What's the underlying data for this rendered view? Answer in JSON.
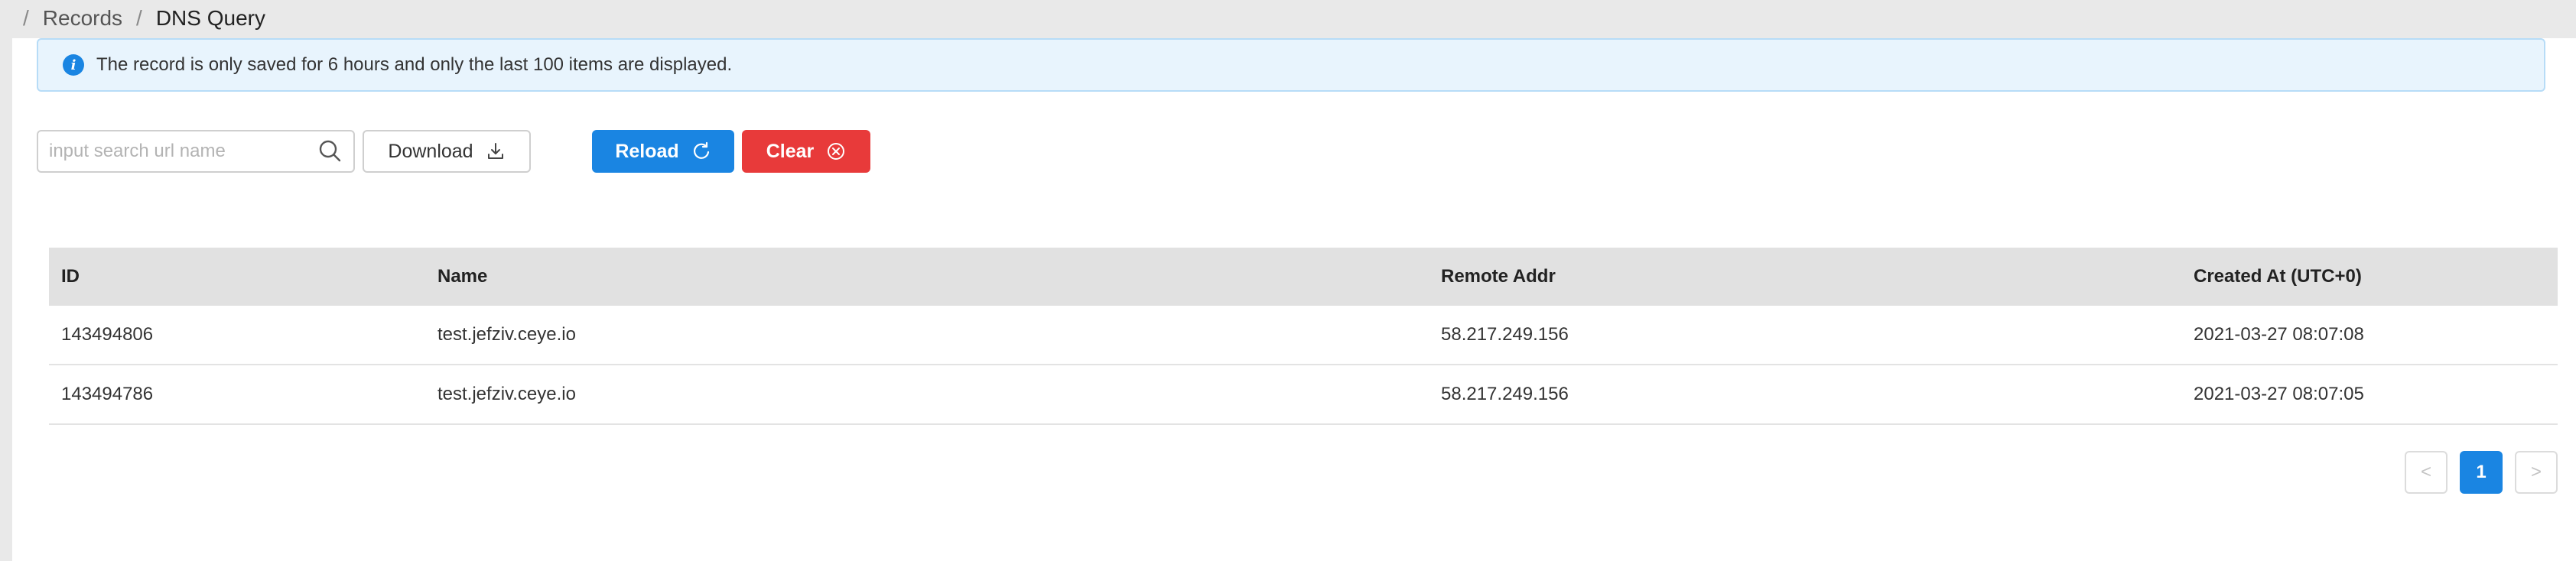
{
  "breadcrumb": {
    "items": [
      "Records",
      "DNS Query"
    ]
  },
  "alert": {
    "text": "The record is only saved for 6 hours and only the last 100 items are displayed.",
    "icon": "info-icon"
  },
  "toolbar": {
    "search_placeholder": "input search url name",
    "search_value": "",
    "download_label": "Download",
    "reload_label": "Reload",
    "clear_label": "Clear"
  },
  "table": {
    "columns": [
      "ID",
      "Name",
      "Remote Addr",
      "Created At (UTC+0)"
    ],
    "rows": [
      [
        "143494806",
        "test.jefziv.ceye.io",
        "58.217.249.156",
        "2021-03-27 08:07:08"
      ],
      [
        "143494786",
        "test.jefziv.ceye.io",
        "58.217.249.156",
        "2021-03-27 08:07:05"
      ]
    ]
  },
  "pagination": {
    "prev": "<",
    "current_page": "1",
    "next": ">"
  },
  "colors": {
    "primary": "#1a85e2",
    "danger": "#e83a3a",
    "alert_bg": "#e8f4fd"
  }
}
